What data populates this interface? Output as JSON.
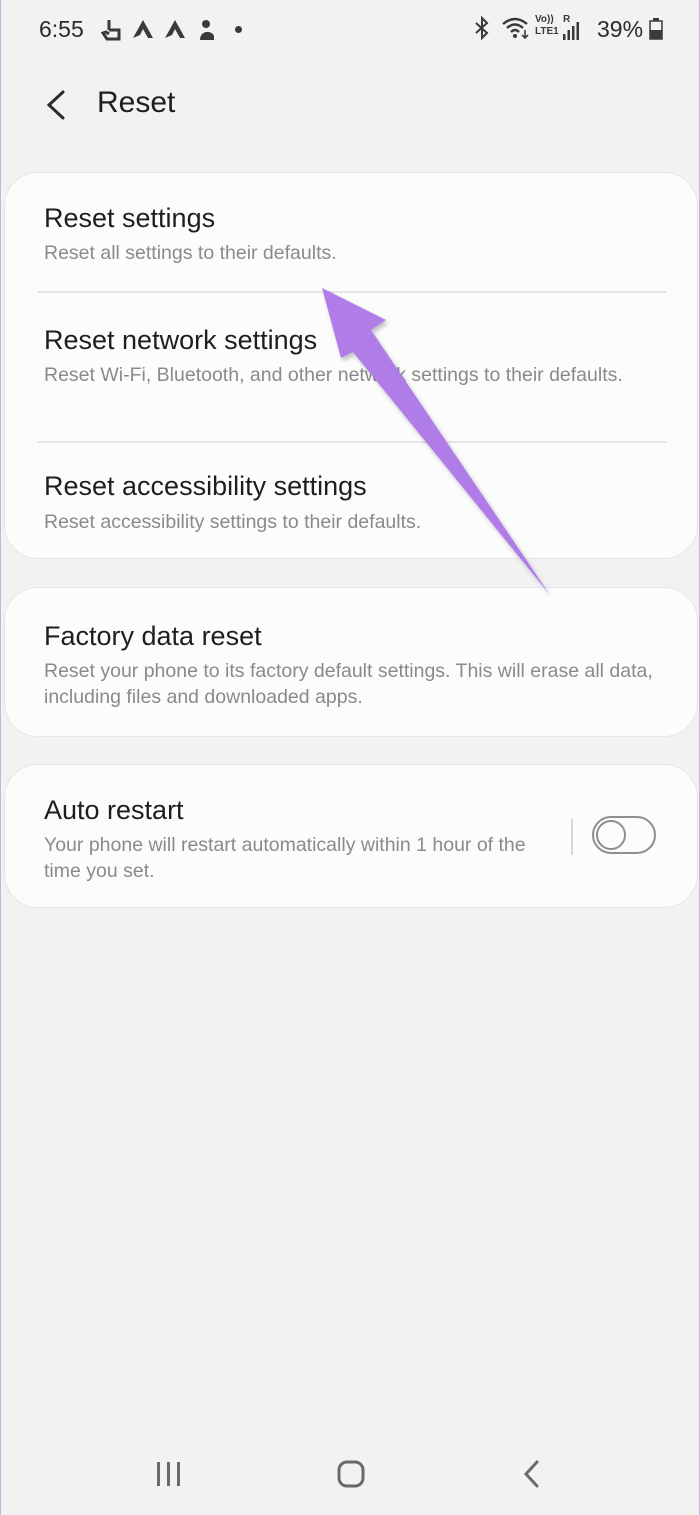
{
  "status_bar": {
    "time": "6:55",
    "notification_icons": [
      "touch-icon",
      "app-a-icon",
      "app-a-icon",
      "app-hand-icon"
    ],
    "system_icons": [
      "bluetooth-icon",
      "wifi-icon",
      "volte-lte-icon",
      "signal-icon"
    ],
    "volte_label": "Vo))",
    "lte_label": "LTE1",
    "roaming_label": "R",
    "battery_percent": "39%"
  },
  "header": {
    "title": "Reset",
    "back_icon": "chevron-left-icon"
  },
  "reset_group": {
    "items": [
      {
        "title": "Reset settings",
        "description": "Reset all settings to their defaults."
      },
      {
        "title": "Reset network settings",
        "description": "Reset Wi-Fi, Bluetooth, and other network settings to their defaults."
      },
      {
        "title": "Reset accessibility settings",
        "description": "Reset accessibility settings to their defaults."
      }
    ]
  },
  "factory_reset": {
    "title": "Factory data reset",
    "description": "Reset your phone to its factory default settings. This will erase all data, including files and downloaded apps."
  },
  "auto_restart": {
    "title": "Auto restart",
    "description": "Your phone will restart automatically within 1 hour of the time you set.",
    "enabled": false
  },
  "nav_bar": {
    "buttons": [
      "recent-apps-icon",
      "home-icon",
      "back-icon"
    ]
  },
  "colors": {
    "background": "#f3f2f3",
    "card": "#fcfcfc",
    "annotation_arrow": "#b07de8"
  }
}
